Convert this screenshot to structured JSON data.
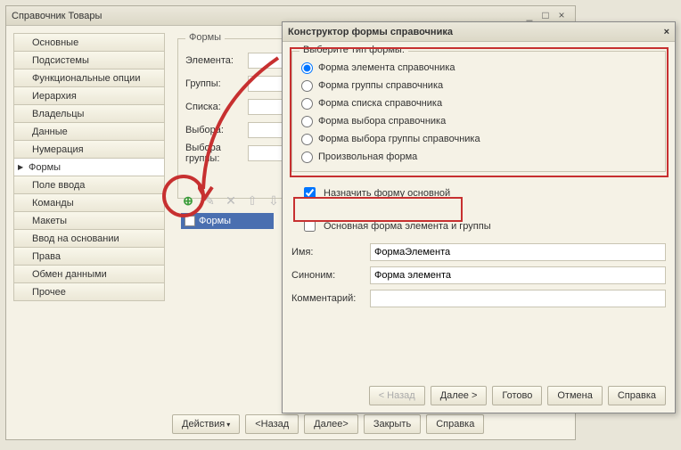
{
  "mainWindow": {
    "title": "Справочник Товары"
  },
  "sidebar": [
    "Основные",
    "Подсистемы",
    "Функциональные опции",
    "Иерархия",
    "Владельцы",
    "Данные",
    "Нумерация",
    "Формы",
    "Поле ввода",
    "Команды",
    "Макеты",
    "Ввод на основании",
    "Права",
    "Обмен данными",
    "Прочее"
  ],
  "sidebarActiveIndex": 7,
  "formsGroup": {
    "title": "Формы",
    "rows": [
      "Элемента:",
      "Группы:",
      "Списка:",
      "Выбора:",
      "Выбора группы:"
    ]
  },
  "treeItem": "Формы",
  "bottomBar": [
    "Действия",
    "<Назад",
    "Далее>",
    "Закрыть",
    "Справка"
  ],
  "dialog": {
    "title": "Конструктор формы справочника",
    "formTypeGroup": {
      "legend": "Выберите тип формы:",
      "options": [
        "Форма элемента справочника",
        "Форма группы справочника",
        "Форма списка справочника",
        "Форма выбора справочника",
        "Форма выбора группы справочника",
        "Произвольная форма"
      ],
      "selectedIndex": 0
    },
    "assignMain": {
      "label": "Назначить форму основной",
      "checked": true
    },
    "mainFormElemGroup": {
      "label": "Основная форма элемента и группы",
      "checked": false
    },
    "nameRow": {
      "label": "Имя:",
      "value": "ФормаЭлемента"
    },
    "synonymRow": {
      "label": "Синоним:",
      "value": "Форма элемента"
    },
    "commentRow": {
      "label": "Комментарий:",
      "value": ""
    },
    "buttons": [
      "< Назад",
      "Далее >",
      "Готово",
      "Отмена",
      "Справка"
    ]
  }
}
